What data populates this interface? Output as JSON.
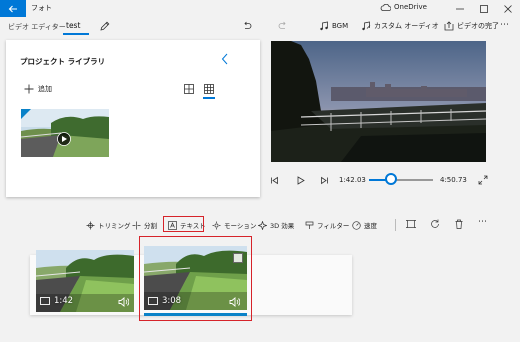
{
  "window": {
    "title": "フォト",
    "onedrive_label": "OneDrive"
  },
  "header": {
    "breadcrumb": "ビデオ エディター",
    "separator": "›",
    "project_name": "test",
    "bgm_label": "BGM",
    "custom_audio_label": "カスタム オーディオ",
    "finish_video_label": "ビデオの完了",
    "more_label": "⋯"
  },
  "library": {
    "title": "プロジェクト ライブラリ",
    "add_label": "追加"
  },
  "preview": {
    "current_time": "1:42.03",
    "duration": "4:50.73",
    "progress": 0.35
  },
  "toolbar": {
    "trim_label": "トリミング",
    "split_label": "分割",
    "text_label": "テキスト",
    "motion_label": "モーション",
    "effects_3d_label": "3D 効果",
    "filter_label": "フィルター",
    "speed_label": "速度",
    "more_label": "⋯"
  },
  "storyboard": {
    "clips": [
      {
        "duration": "1:42",
        "selected": false
      },
      {
        "duration": "3:08",
        "selected": true
      }
    ]
  },
  "colors": {
    "accent": "#0078d7",
    "highlight_box": "#d6232a"
  }
}
